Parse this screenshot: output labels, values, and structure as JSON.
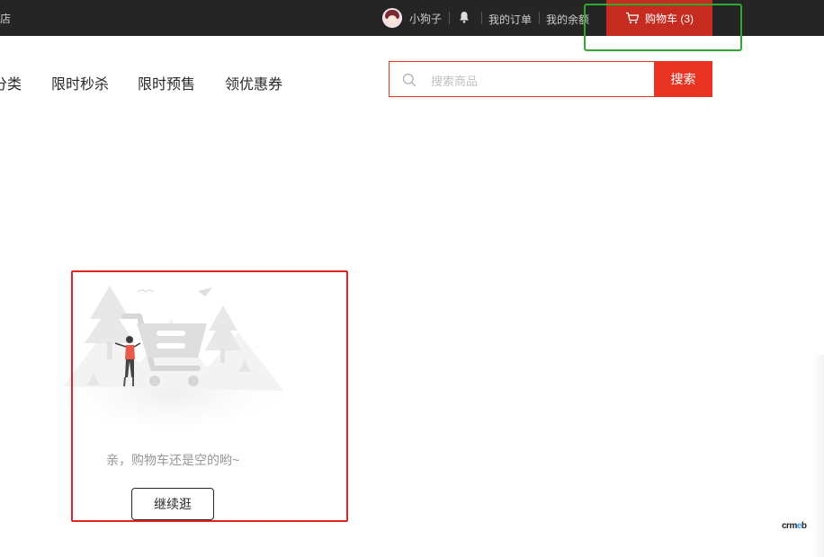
{
  "topbar": {
    "store_fragment": "店",
    "username": "小狗子",
    "links": {
      "orders": "我的订单",
      "balance": "我的余额"
    },
    "cart_label": "购物车 (3)"
  },
  "nav": {
    "items": [
      "分类",
      "限时秒杀",
      "限时预售",
      "领优惠券"
    ]
  },
  "search": {
    "placeholder": "搜索商品",
    "value": "",
    "button": "搜索"
  },
  "cart": {
    "empty_message": "亲，购物车还是空的哟~",
    "continue_button": "继续逛"
  },
  "brand": {
    "text_a": "crm",
    "text_b": "e",
    "text_c": "b"
  },
  "colors": {
    "topbar_bg": "#252525",
    "accent_red": "#e93323",
    "cart_button_red": "#c62b1f",
    "highlight_green": "#2eaa2e",
    "highlight_red": "#e02525"
  },
  "icons": [
    "user-avatar",
    "bell-icon",
    "cart-icon",
    "search-icon",
    "empty-cart-illustration"
  ]
}
